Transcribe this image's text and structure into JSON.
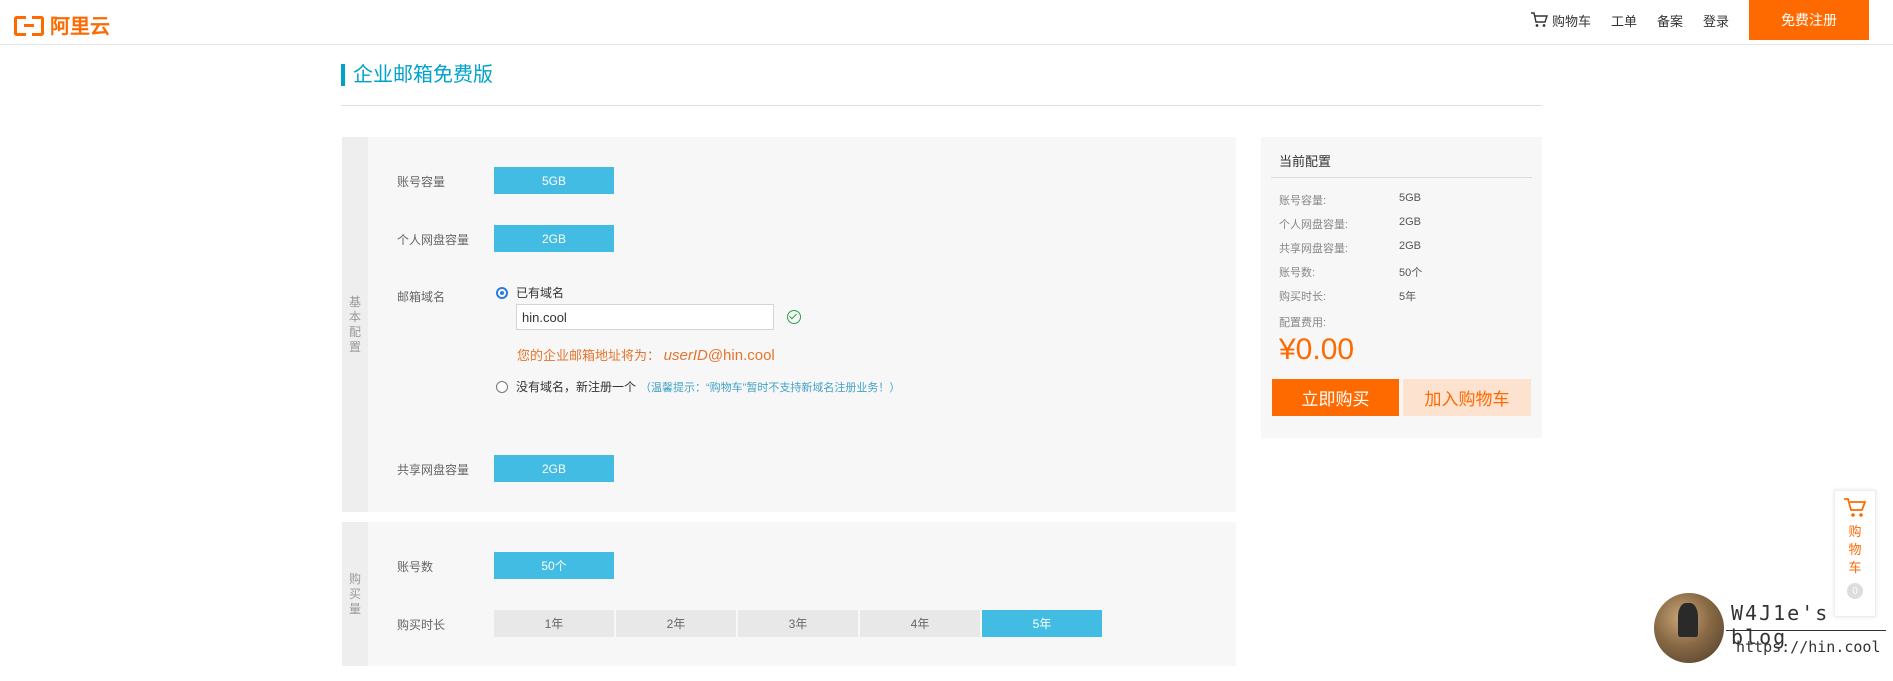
{
  "header": {
    "logo_text": "阿里云",
    "cart_label": "购物车",
    "ticket_label": "工单",
    "beian_label": "备案",
    "login_label": "登录",
    "signup_label": "免费注册"
  },
  "page": {
    "title": "企业邮箱免费版"
  },
  "basic": {
    "side_label": "基本配置",
    "capacity": {
      "label": "账号容量",
      "value": "5GB"
    },
    "personal_disk": {
      "label": "个人网盘容量",
      "value": "2GB"
    },
    "domain": {
      "label": "邮箱域名",
      "has_domain_label": "已有域名",
      "input_value": "hin.cool",
      "hint_prefix": "您的企业邮箱地址将为：",
      "hint_user": "userID",
      "hint_suffix": "@hin.cool",
      "no_domain_label": "没有域名，新注册一个",
      "no_domain_tip": "（温馨提示：“购物车”暂时不支持新域名注册业务！）"
    },
    "shared_disk": {
      "label": "共享网盘容量",
      "value": "2GB"
    }
  },
  "purchase": {
    "side_label": "购买量",
    "accounts": {
      "label": "账号数",
      "value": "50个"
    },
    "duration": {
      "label": "购买时长",
      "options": [
        "1年",
        "2年",
        "3年",
        "4年",
        "5年"
      ],
      "selected": "5年"
    }
  },
  "summary": {
    "title": "当前配置",
    "rows": [
      {
        "label": "账号容量:",
        "value": "5GB"
      },
      {
        "label": "个人网盘容量:",
        "value": "2GB"
      },
      {
        "label": "共享网盘容量:",
        "value": "2GB"
      },
      {
        "label": "账号数:",
        "value": "50个"
      },
      {
        "label": "购买时长:",
        "value": "5年"
      }
    ],
    "fee_label": "配置费用:",
    "price": "¥0.00",
    "buy_label": "立即购买",
    "add_cart_label": "加入购物车"
  },
  "float_cart": {
    "label": "购物车",
    "count": "0"
  },
  "watermark": {
    "title": "W4J1e's blog",
    "url": "https://hin.cool"
  },
  "colors": {
    "accent": "#ff6a00",
    "selected": "#43bce3",
    "title": "#00a2ca"
  }
}
